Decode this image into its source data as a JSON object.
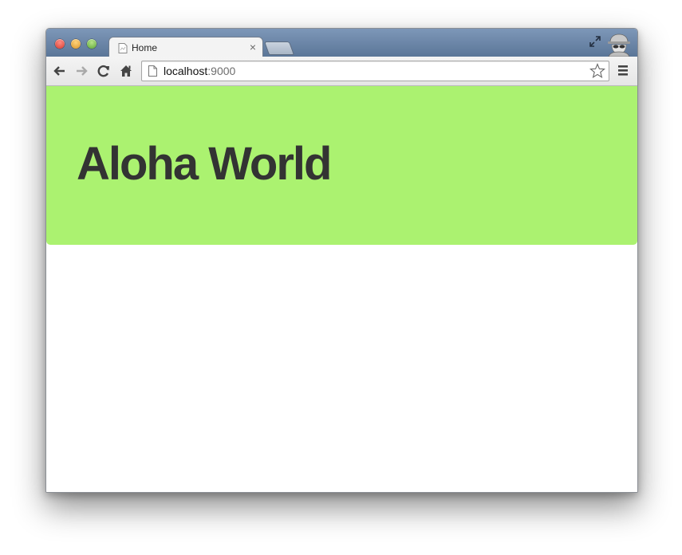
{
  "browser": {
    "tab": {
      "title": "Home",
      "close_glyph": "×",
      "icon": "page-favicon-icon"
    },
    "new_tab_icon": "new-tab-icon",
    "fullscreen_icon": "fullscreen-icon",
    "profile_icon": "incognito-icon",
    "toolbar": {
      "back_icon": "back-arrow-icon",
      "forward_icon": "forward-arrow-icon",
      "reload_icon": "reload-icon",
      "home_icon": "home-icon",
      "menu_icon": "menu-icon"
    },
    "address": {
      "host": "localhost",
      "port": ":9000",
      "bookmark_icon": "star-icon"
    }
  },
  "page": {
    "heading": "Aloha World",
    "colors": {
      "hero_background": "#abf270",
      "heading_text": "#333333"
    }
  }
}
